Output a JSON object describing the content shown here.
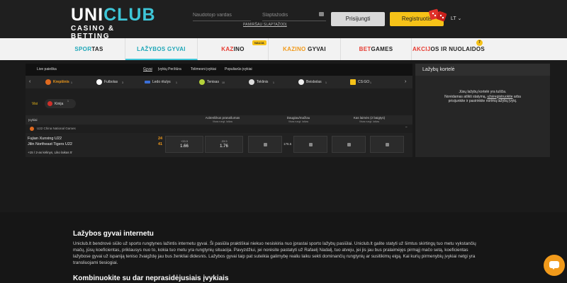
{
  "header": {
    "logo": {
      "part1": "UNI",
      "part2": "CLUB",
      "sub": "CASINO & BETTING"
    },
    "username_placeholder": "Naudotojo vardas",
    "password_placeholder": "Slaptažodis",
    "forgot": "PAMIRŠAU SLAPTAŽODĮ",
    "login": "Prisijungti",
    "register": "Registruotis",
    "lang": "LT"
  },
  "nav": {
    "items": [
      {
        "pre": "SPOR",
        "rest": "TAS"
      },
      {
        "pre": "LAŽYBOS GYVAI",
        "rest": ""
      },
      {
        "pre": "KAZ",
        "rest": "INO"
      },
      {
        "pre": "KAZINO",
        "rest": " GYVAI"
      },
      {
        "pre": "BET",
        "rest": "GAMES"
      },
      {
        "pre": "AKCIJ",
        "rest": "OS IR NUOLAIDOS"
      }
    ],
    "badge_new": "NAUJA",
    "promo_count": "7"
  },
  "live": {
    "tabs": [
      "Live paieška",
      "Gyvai",
      "Įvykių Peržiūra",
      "Tolimesni įvykiai",
      "Populiarūs įvykiai"
    ],
    "sports": [
      {
        "name": "Krepšinis",
        "count": "1"
      },
      {
        "name": "Futbolas",
        "count": "3"
      },
      {
        "name": "Ledo ritulys",
        "count": "1"
      },
      {
        "name": "Tenisas",
        "count": "10"
      },
      {
        "name": "Teklinis",
        "count": "1"
      },
      {
        "name": "Beisbolas",
        "count": "1"
      },
      {
        "name": "CS:GO",
        "count": "1"
      }
    ],
    "filter_all": "Visi",
    "filter_country": "Kinija",
    "filter_count": "1",
    "table": {
      "col_events": "Įvykiai",
      "col1": "Acitenliikus pranašumas",
      "col1_sub": "Visas rungt. laikas",
      "col2": "Daugiau/mažiau",
      "col2_sub": "Visas rungt. laikas",
      "col3": "Kas laimės (2 baigtys)",
      "col3_sub": "Visas rungt. laikas"
    },
    "league": "U22 China National Games",
    "match": {
      "team1": "Fujian Xunxing U22",
      "team2": "Jilin Northeast Tigers U22",
      "score1": "24",
      "score2": "41",
      "meta": "+15 / 2-as kėlinys, Liko laikas 5'",
      "odd1_h": "+33.5",
      "odd1_v": "1.66",
      "odd2_h": "-33.5",
      "odd2_v": "1.76",
      "total": "176.5"
    }
  },
  "slip": {
    "title": "Lažybų kortelė",
    "line1": "Jūsų lažybų kortelė yra tuščia.",
    "line2": "Norėdamas atlikti statymą,",
    "link": "užsiregistruokite",
    "line2b": "arba",
    "line3": "prisijunkite ir pasirinkite norimą lažybų įvykį."
  },
  "info": {
    "title": "Lažybos gyvai internetu",
    "body": "Uniclub.lt bendrovė siūlo už sporto rungtynes lažintis internetu gyvai. Ši pasiūla praktiškai niekuo nesiskiria nuo įprastai sporto lažybų pasiūlai. Uniclub.lt galite statyti už šimtus skirtingų tuo metu vykstančių mačų, jūsų koeficientas, priklausys nuo to, kokia tuo metu yra rungtynių situacija. Pavyzdžiui, jei norėsite pastatyti už Rafaelį Nadalį, tuo atveju, jei jis jau bus pralaimėjęs pirmąjį mačo setą, koeficientas lažybose gyvai už ispaniją teniso žvaigždę jau bus ženkliai didesnis. Lažybos gyvai taip pat suteikia galimybę realiu laiku sekti dominančių rungtynių ar susitikimų eigą. Kai kurių pirmenybių įvykiai netgi yra transliuojami tiesiogiai.",
    "subtitle": "Kombinuokite su dar neprasidėjusiais įvykiais"
  },
  "colors": {
    "accent": "#3ec6d8",
    "yellow": "#f6c218",
    "orange": "#f19a1b"
  }
}
